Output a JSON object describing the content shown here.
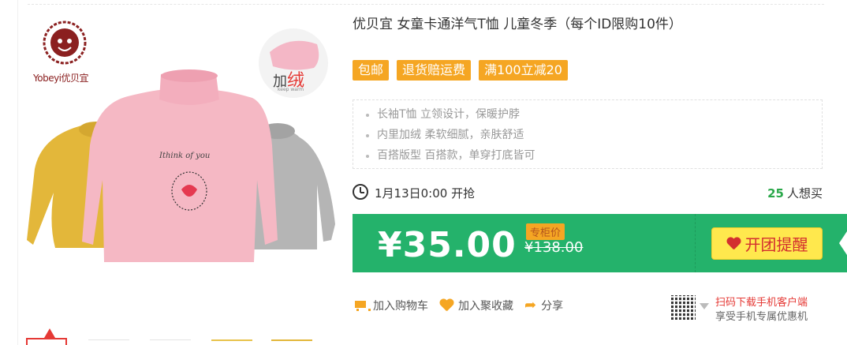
{
  "product": {
    "title": "优贝宜 女童卡通洋气T恤 儿童冬季（每个ID限购10件）",
    "brand_logo_text": "Yobeyi优贝宜",
    "badge_main": "加",
    "badge_red": "绒",
    "badge_sub": "keep warm",
    "shirt_print": "Ithink of you"
  },
  "tags": [
    "包邮",
    "退货赔运费",
    "满100立减20"
  ],
  "features": [
    "长袖T恤 立领设计，保暖护脖",
    "内里加绒 柔软细腻，亲肤舒适",
    "百搭版型 百搭款，单穿打底皆可"
  ],
  "sale": {
    "start_time": "1月13日0:00 开抢",
    "want_count": "25",
    "want_label": "人想买"
  },
  "price": {
    "current": "¥35.00",
    "original_label": "专柜价",
    "original": "¥138.00",
    "remind_button": "开团提醒"
  },
  "actions": {
    "add_cart": "加入购物车",
    "add_fav": "加入聚收藏",
    "share": "分享"
  },
  "app_promo": {
    "line1": "扫码下载手机客户端",
    "line2": "享受手机专属优惠机"
  },
  "colors": {
    "accent_green": "#24b26b",
    "tag_orange": "#f5a623",
    "button_yellow": "#ffe84d",
    "sweater_pink": "#f5b8c4",
    "sweater_yellow": "#e3b73a",
    "sweater_gray": "#b5b5b5"
  }
}
